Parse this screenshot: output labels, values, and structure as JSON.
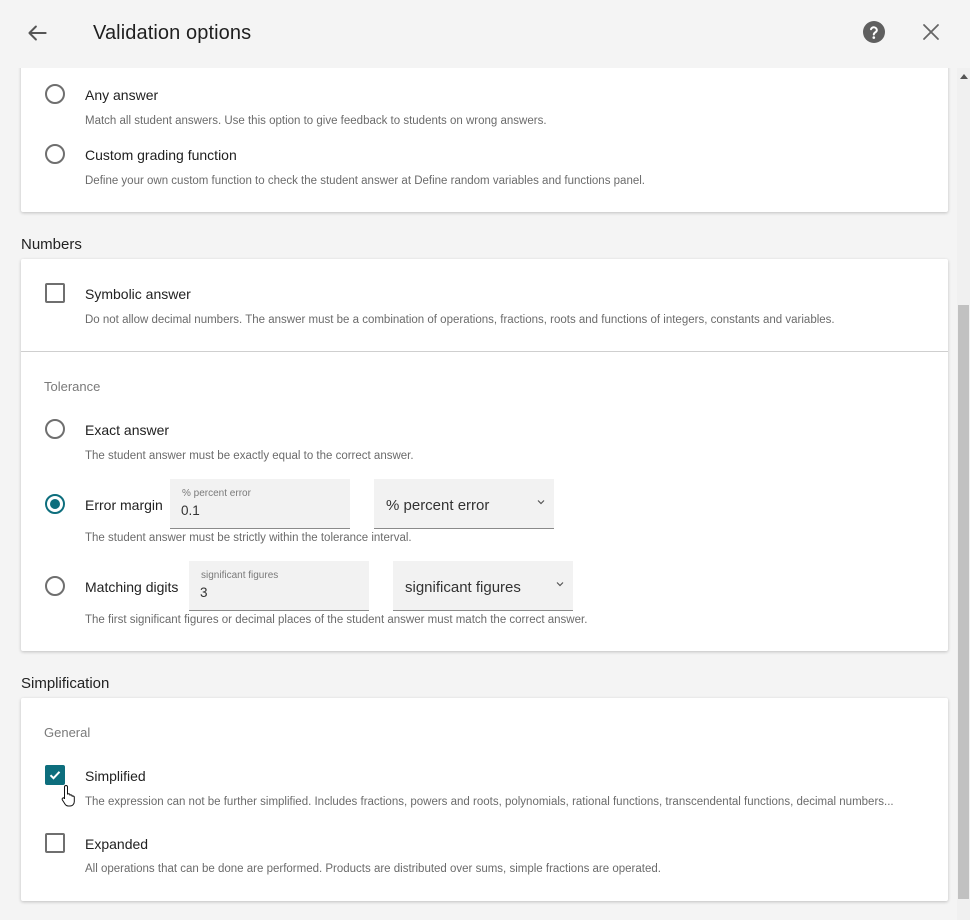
{
  "header": {
    "title": "Validation options"
  },
  "comparison": {
    "any_answer": {
      "label": "Any answer",
      "description": "Match all student answers. Use this option to give feedback to students on wrong answers.",
      "selected": false
    },
    "custom_grading": {
      "label": "Custom grading function",
      "description": "Define your own custom function to check the student answer at Define random variables and functions panel.",
      "selected": false
    }
  },
  "numbers": {
    "title": "Numbers",
    "symbolic": {
      "label": "Symbolic answer",
      "description": "Do not allow decimal numbers. The answer must be a combination of operations, fractions, roots and functions of integers, constants and variables.",
      "checked": false
    },
    "tolerance": {
      "title": "Tolerance",
      "exact": {
        "label": "Exact answer",
        "description": "The student answer must be exactly equal to the correct answer.",
        "selected": false
      },
      "error_margin": {
        "label": "Error margin",
        "field_label": "% percent error",
        "field_value": "0.1",
        "select_value": "% percent error",
        "description": "The student answer must be strictly within the tolerance interval.",
        "selected": true
      },
      "matching_digits": {
        "label": "Matching digits",
        "field_label": "significant figures",
        "field_value": "3",
        "select_value": "significant figures",
        "description": "The first significant figures or decimal places of the student answer must match the correct answer.",
        "selected": false
      }
    }
  },
  "simplification": {
    "title": "Simplification",
    "general": "General",
    "simplified": {
      "label": "Simplified",
      "description": "The expression can not be further simplified. Includes fractions, powers and roots, polynomials, rational functions, transcendental functions, decimal numbers...",
      "checked": true
    },
    "expanded": {
      "label": "Expanded",
      "description": "All operations that can be done are performed. Products are distributed over sums, simple fractions are operated.",
      "checked": false
    }
  },
  "colors": {
    "accent": "#0d6e7d",
    "background": "#f4f4f4",
    "card": "#ffffff"
  },
  "icons": {
    "back": "arrow-left",
    "help": "question-circle",
    "close": "x",
    "select_chevron": "chevron-down",
    "checkbox_tick": "check"
  }
}
